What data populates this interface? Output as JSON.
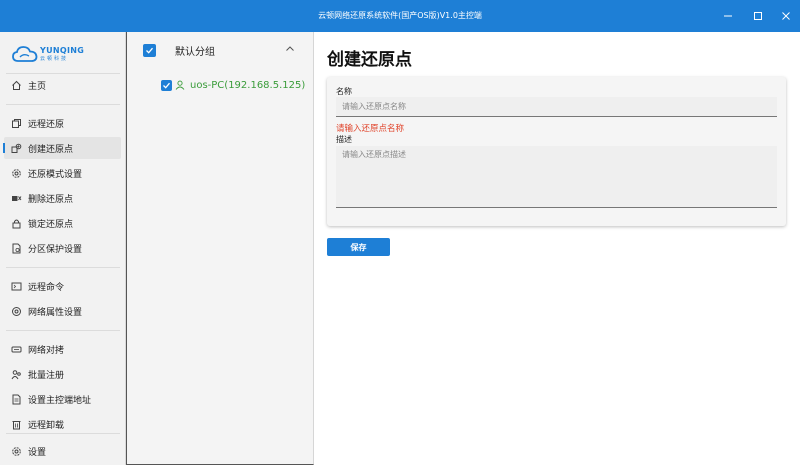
{
  "window": {
    "title": "云顿网络还原系统软件(国产OS版)V1.0主控端"
  },
  "logo": {
    "brand": "YUNQING",
    "brand_cn": "云顿科技"
  },
  "sidebar": {
    "items": [
      {
        "label": "主页",
        "icon": "home-icon"
      },
      {
        "label": "远程还原",
        "icon": "copy-icon"
      },
      {
        "label": "创建还原点",
        "icon": "create-restore-icon",
        "active": true
      },
      {
        "label": "还原模式设置",
        "icon": "gear-icon"
      },
      {
        "label": "删除还原点",
        "icon": "delete-icon"
      },
      {
        "label": "锁定还原点",
        "icon": "lock-icon"
      },
      {
        "label": "分区保护设置",
        "icon": "document-icon"
      },
      {
        "label": "远程命令",
        "icon": "terminal-icon"
      },
      {
        "label": "网络属性设置",
        "icon": "network-icon"
      },
      {
        "label": "网络对拷",
        "icon": "disk-icon"
      },
      {
        "label": "批量注册",
        "icon": "users-icon"
      },
      {
        "label": "设置主控端地址",
        "icon": "address-icon"
      },
      {
        "label": "远程卸载",
        "icon": "trash-icon"
      },
      {
        "label": "设置",
        "icon": "settings-icon"
      }
    ]
  },
  "group": {
    "name": "默认分组",
    "checked": true,
    "devices": [
      {
        "name": "uos-PC(192.168.5.125)",
        "checked": true
      }
    ]
  },
  "main": {
    "title": "创建还原点",
    "name_label": "名称",
    "name_placeholder": "请输入还原点名称",
    "name_error": "请输入还原点名称",
    "desc_label": "描述",
    "desc_placeholder": "请输入还原点描述",
    "save_label": "保存"
  },
  "colors": {
    "accent": "#1e7fd6",
    "error": "#e0442b",
    "device_online": "#3a9c3a"
  }
}
